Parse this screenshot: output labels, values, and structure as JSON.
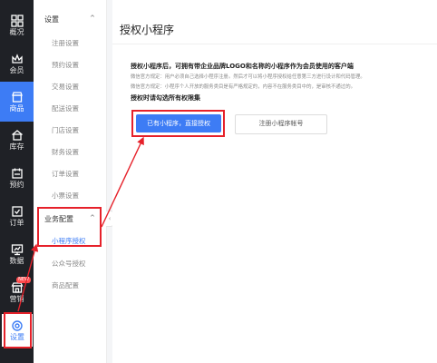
{
  "nav": [
    {
      "key": "overview",
      "label": "概况",
      "icon": "grid-icon"
    },
    {
      "key": "members",
      "label": "会员",
      "icon": "crown-icon"
    },
    {
      "key": "products",
      "label": "商品",
      "icon": "store-icon"
    },
    {
      "key": "inventory",
      "label": "库存",
      "icon": "home-icon"
    },
    {
      "key": "booking",
      "label": "预约",
      "icon": "calendar-icon"
    },
    {
      "key": "orders",
      "label": "订单",
      "icon": "checkbox-icon"
    },
    {
      "key": "data",
      "label": "数据",
      "icon": "chart-icon"
    },
    {
      "key": "marketing",
      "label": "营销",
      "icon": "shop-icon",
      "badge": "NEW"
    },
    {
      "key": "store",
      "label": "店铺",
      "icon": "window-icon"
    },
    {
      "key": "settings",
      "label": "设置",
      "icon": "gear-icon"
    }
  ],
  "sub": {
    "group1": {
      "label": "设置",
      "caret": "^"
    },
    "items1": [
      "注册设置",
      "预约设置",
      "交易设置",
      "配送设置",
      "门店设置",
      "财务设置",
      "订单设置",
      "小票设置"
    ],
    "group2": {
      "label": "业务配置",
      "caret": "^"
    },
    "items2": [
      "小程序授权",
      "公众号授权",
      "商品配置"
    ],
    "collapse": "‹"
  },
  "main": {
    "title": "授权小程序",
    "lead": "授权小程序后，可拥有带企业品牌LOGO和名称的小程序作为会员使用的客户端",
    "note1": "微信官方规定：用户必须自己选择小程序注册。然后才可以将小程序授权给任意第三方进行设计和代码管理。",
    "note2": "微信官方规定：小程序个人开放的服务类目是有严格规定的，内容不在服务类目中的，是审核不通过的。",
    "lead2": "授权时请勾选所有权限集",
    "primary_button": "已有小程序，直接授权",
    "secondary_button": "注册小程序帐号"
  }
}
